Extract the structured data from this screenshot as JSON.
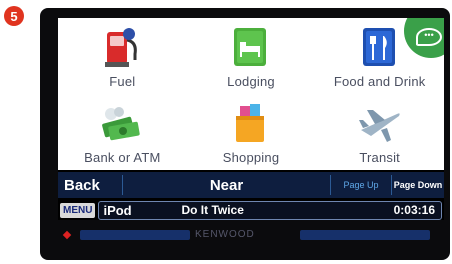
{
  "step": "5",
  "categories": [
    {
      "label": "Fuel",
      "icon": "fuel-pump-icon"
    },
    {
      "label": "Lodging",
      "icon": "bed-icon"
    },
    {
      "label": "Food and Drink",
      "icon": "fork-knife-icon"
    },
    {
      "label": "Bank or ATM",
      "icon": "money-icon"
    },
    {
      "label": "Shopping",
      "icon": "shopping-bag-icon"
    },
    {
      "label": "Transit",
      "icon": "airplane-icon"
    }
  ],
  "nav": {
    "back": "Back",
    "near": "Near",
    "page_up": "Page Up",
    "page_down": "Page Down"
  },
  "now_playing": {
    "menu": "MENU",
    "source": "iPod",
    "track": "Do It Twice",
    "time": "0:03:16"
  },
  "brand": "KENWOOD",
  "colors": {
    "accent_green": "#3aa049",
    "navbar": "#0e1e3f",
    "badge_red": "#e0341f"
  }
}
